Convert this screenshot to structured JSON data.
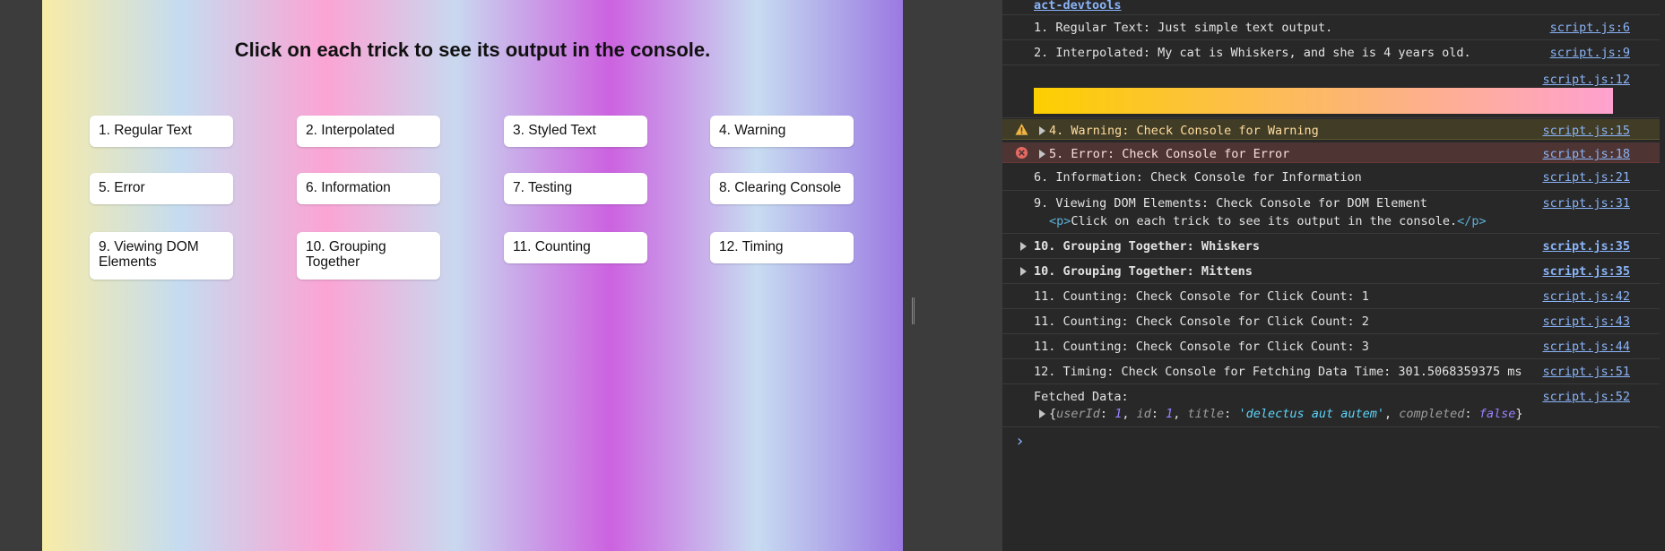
{
  "page": {
    "title": "Click on each trick to see its output in the console.",
    "tricks": [
      "1. Regular Text",
      "2. Interpolated",
      "3. Styled Text",
      "4. Warning",
      "5. Error",
      "6. Information",
      "7. Testing",
      "8. Clearing Console",
      "9. Viewing DOM Elements",
      "10. Grouping Together",
      "11. Counting",
      "12. Timing"
    ]
  },
  "console": {
    "top_link": "act-devtools",
    "rows": {
      "regular": {
        "msg": "1. Regular Text: Just simple text output.",
        "src": "script.js:6"
      },
      "interpolated": {
        "msg": "2. Interpolated: My cat is Whiskers, and she is 4 years old.",
        "src": "script.js:9"
      },
      "styled": {
        "src": "script.js:12"
      },
      "warning": {
        "msg": "4. Warning: Check Console for Warning",
        "src": "script.js:15"
      },
      "error": {
        "msg": "5. Error: Check Console for Error",
        "src": "script.js:18"
      },
      "info": {
        "msg": "6. Information: Check Console for Information",
        "src": "script.js:21"
      },
      "dom": {
        "msg": "9. Viewing DOM Elements: Check Console for DOM Element",
        "src": "script.js:31",
        "open_tag": "<p>",
        "text": "Click on each trick to see its output in the console.",
        "close_tag": "</p>"
      },
      "group1": {
        "msg": "10. Grouping Together: Whiskers",
        "src": "script.js:35"
      },
      "group2": {
        "msg": "10. Grouping Together: Mittens",
        "src": "script.js:35"
      },
      "count1": {
        "msg": "11. Counting: Check Console for Click Count: 1",
        "src": "script.js:42"
      },
      "count2": {
        "msg": "11. Counting: Check Console for Click Count: 2",
        "src": "script.js:43"
      },
      "count3": {
        "msg": "11. Counting: Check Console for Click Count: 3",
        "src": "script.js:44"
      },
      "timing": {
        "msg": "12. Timing: Check Console for Fetching Data Time: 301.5068359375 ms",
        "src": "script.js:51"
      },
      "fetched": {
        "msg": "Fetched Data:",
        "src": "script.js:52"
      }
    },
    "object": {
      "open": "{",
      "k1": "userId",
      "v1": "1",
      "k2": "id",
      "v2": "1",
      "k3": "title",
      "v3": "'delectus aut autem'",
      "k4": "completed",
      "v4": "false",
      "close": "}"
    },
    "prompt": "›"
  },
  "colors": {
    "warning_bg": "#413c26",
    "error_bg": "#4e3534",
    "styled_gradient_start": "#fccf00",
    "styled_gradient_end": "#fea1d0"
  }
}
